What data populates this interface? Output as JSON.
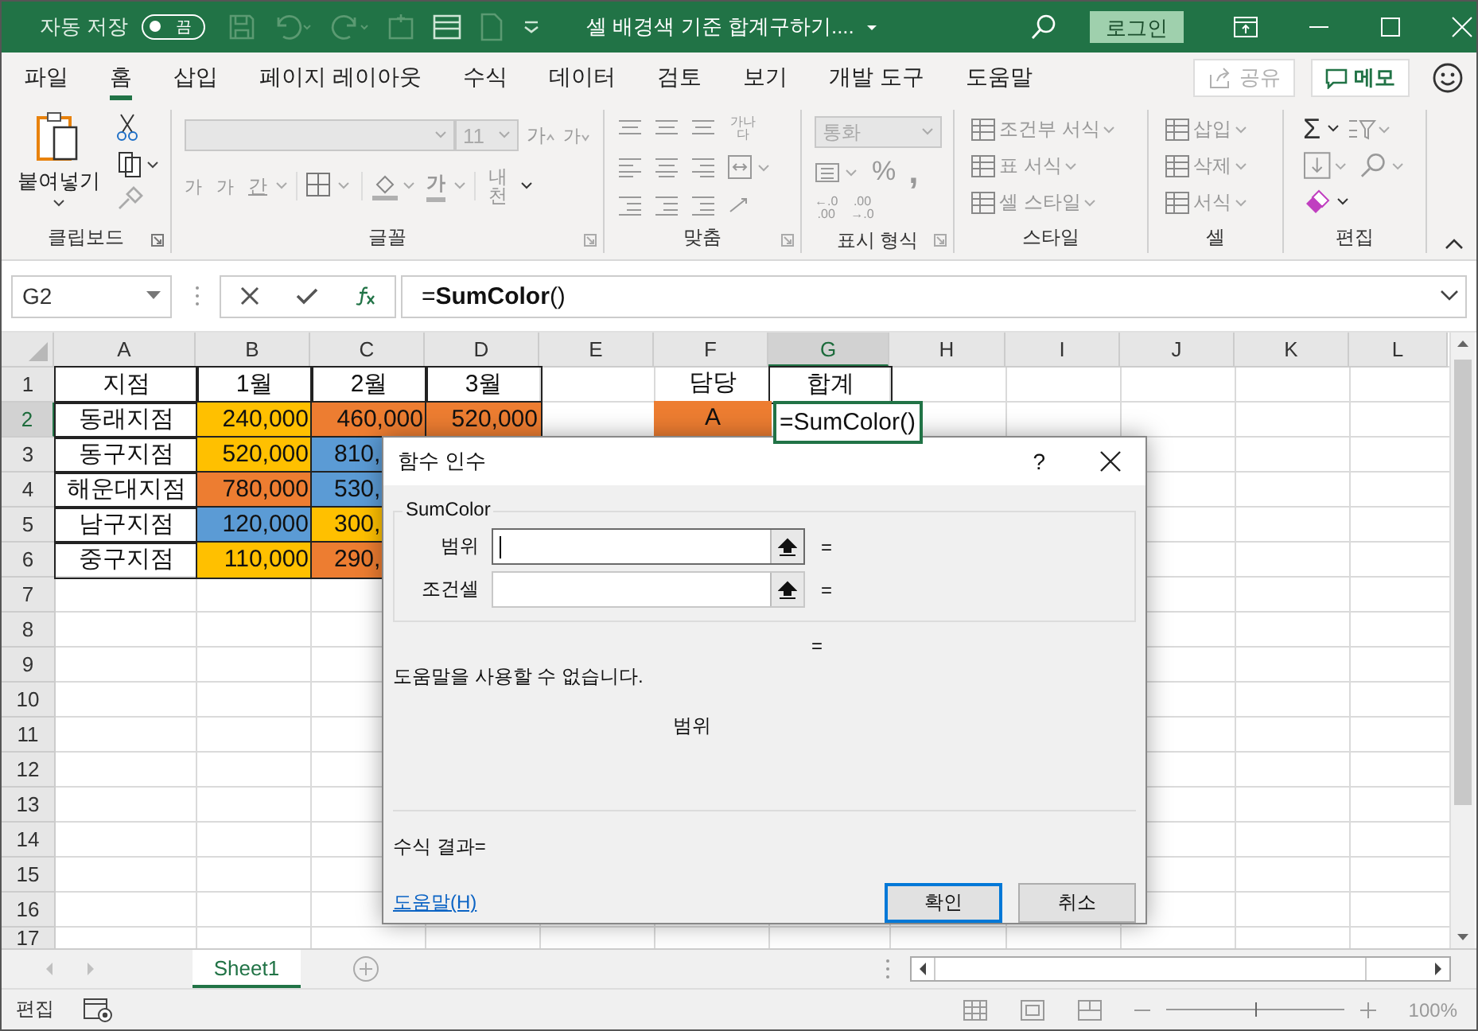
{
  "title_bar": {
    "autosave_label": "자동 저장",
    "autosave_toggle": {
      "label": "끔",
      "on": false
    },
    "title": "셀 배경색 기준 합계구하기....",
    "login": "로그인"
  },
  "menu_tabs": [
    {
      "label": "파일",
      "selected": false
    },
    {
      "label": "홈",
      "selected": true
    },
    {
      "label": "삽입",
      "selected": false
    },
    {
      "label": "페이지 레이아웃",
      "selected": false
    },
    {
      "label": "수식",
      "selected": false
    },
    {
      "label": "데이터",
      "selected": false
    },
    {
      "label": "검토",
      "selected": false
    },
    {
      "label": "보기",
      "selected": false
    },
    {
      "label": "개발 도구",
      "selected": false
    },
    {
      "label": "도움말",
      "selected": false
    }
  ],
  "share_button": "공유",
  "memo_button": "메모",
  "ribbon": {
    "groups": [
      "클립보드",
      "글꼴",
      "맞춤",
      "표시 형식",
      "스타일",
      "셀",
      "편집"
    ],
    "paste": "붙여넣기",
    "font_size": "11",
    "grow_font": "가",
    "shrink_font": "가",
    "bold": "가",
    "italic": "가",
    "underline": "간",
    "font_color": "가",
    "phonetic": "내천",
    "wrap_text": "가나다",
    "number_format": "통화",
    "percent": "%",
    "comma": ",",
    "increase_decimal": [
      "←.0",
      ".00"
    ],
    "decrease_decimal": [
      ".00",
      "→.0"
    ],
    "styles": [
      "조건부 서식",
      "표 서식",
      "셀 스타일"
    ],
    "cells": [
      "삽입",
      "삭제",
      "서식"
    ],
    "sum": "Σ"
  },
  "formula_bar": {
    "name_box": "G2",
    "formula": "=**SumColor**()"
  },
  "columns": [
    {
      "label": "A",
      "selected": false
    },
    {
      "label": "B",
      "selected": false
    },
    {
      "label": "C",
      "selected": false
    },
    {
      "label": "D",
      "selected": false
    },
    {
      "label": "E",
      "selected": false
    },
    {
      "label": "F",
      "selected": false
    },
    {
      "label": "G",
      "selected": true
    },
    {
      "label": "H",
      "selected": false
    },
    {
      "label": "I",
      "selected": false
    },
    {
      "label": "J",
      "selected": false
    },
    {
      "label": "K",
      "selected": false
    },
    {
      "label": "L",
      "selected": false
    }
  ],
  "rows": [
    {
      "label": "1",
      "selected": false,
      "cells": [
        {
          "text": "지점",
          "bordered": true
        },
        {
          "text": "1월",
          "bordered": true
        },
        {
          "text": "2월",
          "bordered": true
        },
        {
          "text": "3월",
          "bordered": true
        },
        {},
        {
          "text": "담당"
        },
        {
          "text": "합계",
          "bordered": true
        }
      ]
    },
    {
      "label": "2",
      "selected": true,
      "cells": [
        {
          "text": "동래지점",
          "bordered": true
        },
        {
          "text": "240,000",
          "kind": "number",
          "color": "#ffc000",
          "bordered": true
        },
        {
          "text": "460,000",
          "kind": "number",
          "color": "#ed7d31",
          "bordered": true
        },
        {
          "text": "520,000",
          "kind": "number",
          "color": "#ed7d31",
          "bordered": true
        },
        {},
        {
          "text": "A",
          "color": "#ed7d31"
        },
        {
          "text": "=SumColor()",
          "kind": "formula",
          "active": true
        }
      ]
    },
    {
      "label": "3",
      "selected": false,
      "cells": [
        {
          "text": "동구지점",
          "bordered": true
        },
        {
          "text": "520,000",
          "kind": "number",
          "color": "#ffc000",
          "bordered": true
        },
        {
          "text": "810,",
          "kind": "clipped",
          "color": "#5b9bd5",
          "bordered": true
        }
      ]
    },
    {
      "label": "4",
      "selected": false,
      "cells": [
        {
          "text": "해운대지점",
          "bordered": true
        },
        {
          "text": "780,000",
          "kind": "number",
          "color": "#ed7d31",
          "bordered": true
        },
        {
          "text": "530,",
          "kind": "clipped",
          "color": "#5b9bd5",
          "bordered": true
        }
      ]
    },
    {
      "label": "5",
      "selected": false,
      "cells": [
        {
          "text": "남구지점",
          "bordered": true
        },
        {
          "text": "120,000",
          "kind": "number",
          "color": "#5b9bd5",
          "bordered": true
        },
        {
          "text": "300,",
          "kind": "clipped",
          "color": "#ffc000",
          "bordered": true
        }
      ]
    },
    {
      "label": "6",
      "selected": false,
      "cells": [
        {
          "text": "중구지점",
          "bordered": true
        },
        {
          "text": "110,000",
          "kind": "number",
          "color": "#ffc000",
          "bordered": true
        },
        {
          "text": "290,",
          "kind": "clipped",
          "color": "#ed7d31",
          "bordered": true
        }
      ]
    },
    {
      "label": "7",
      "selected": false
    },
    {
      "label": "8",
      "selected": false
    },
    {
      "label": "9",
      "selected": false
    },
    {
      "label": "10",
      "selected": false
    },
    {
      "label": "11",
      "selected": false
    },
    {
      "label": "12",
      "selected": false
    },
    {
      "label": "13",
      "selected": false
    },
    {
      "label": "14",
      "selected": false
    },
    {
      "label": "15",
      "selected": false
    },
    {
      "label": "16",
      "selected": false
    },
    {
      "label": "17",
      "selected": false
    }
  ],
  "dialog": {
    "title": "함수 인수",
    "help_glyph": "?",
    "function_name": "SumColor",
    "arguments": [
      {
        "label": "범위",
        "focused": true,
        "result": "="
      },
      {
        "label": "조건셀",
        "focused": false,
        "result": "="
      }
    ],
    "result_equals": "=",
    "description": "도움말을 사용할 수 없습니다.",
    "argument_help": "범위",
    "formula_result": "수식 결과=",
    "help_link": "도움말(H)",
    "buttons": [
      {
        "label": "확인",
        "default": true
      },
      {
        "label": "취소",
        "default": false
      }
    ]
  },
  "sheet_tabs": [
    {
      "label": "Sheet1",
      "selected": true
    }
  ],
  "status_bar": {
    "mode": "편집",
    "zoom": {
      "level": 0.5,
      "reading": "100%"
    }
  }
}
